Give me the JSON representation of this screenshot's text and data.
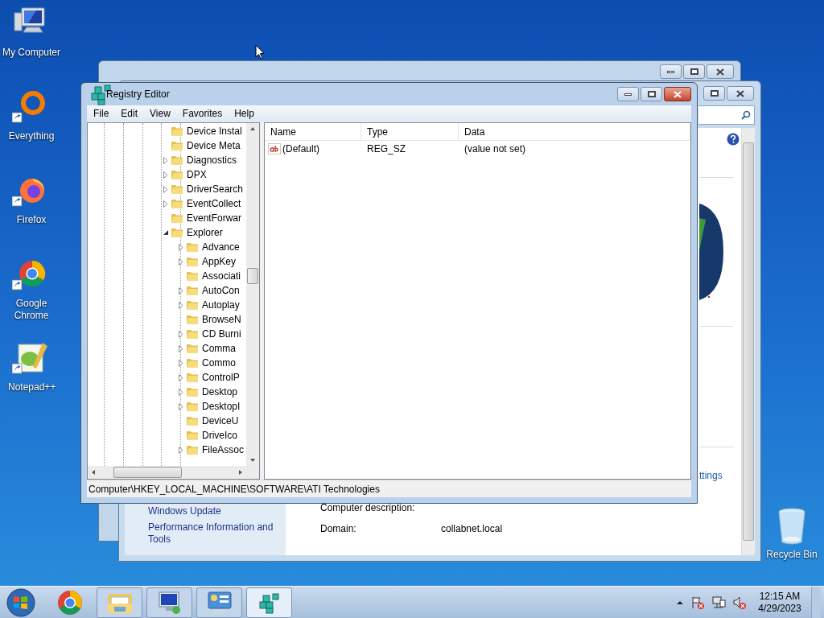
{
  "desktop_icons": [
    {
      "label": "My Computer",
      "kind": "computer",
      "shortcut": false
    },
    {
      "label": "Everything",
      "kind": "everything",
      "shortcut": true
    },
    {
      "label": "Firefox",
      "kind": "firefox",
      "shortcut": true
    },
    {
      "label": "Google Chrome",
      "kind": "chrome",
      "shortcut": true
    },
    {
      "label": "Notepad++",
      "kind": "notepad",
      "shortcut": true
    }
  ],
  "recycle_bin": {
    "label": "Recycle Bin"
  },
  "system_window": {
    "sidebar_links": [
      "Windows Update",
      "Performance Information and Tools"
    ],
    "fields": [
      {
        "label": "Computer description:"
      },
      {
        "label": "Domain:",
        "value": "collabnet.local"
      }
    ],
    "link_fragment": "ttings"
  },
  "registry_editor": {
    "title": "Registry Editor",
    "menu": [
      "File",
      "Edit",
      "View",
      "Favorites",
      "Help"
    ],
    "tree": [
      {
        "label": "Device Instal",
        "has_children": false,
        "expanded": false
      },
      {
        "label": "Device Meta",
        "has_children": false,
        "expanded": false
      },
      {
        "label": "Diagnostics",
        "has_children": true,
        "expanded": false
      },
      {
        "label": "DPX",
        "has_children": true,
        "expanded": false
      },
      {
        "label": "DriverSearch",
        "has_children": true,
        "expanded": false
      },
      {
        "label": "EventCollect",
        "has_children": true,
        "expanded": false
      },
      {
        "label": "EventForwar",
        "has_children": false,
        "expanded": false
      },
      {
        "label": "Explorer",
        "has_children": true,
        "expanded": true,
        "children": [
          {
            "label": "Advance",
            "has_children": true,
            "expanded": false
          },
          {
            "label": "AppKey",
            "has_children": true,
            "expanded": false
          },
          {
            "label": "Associati",
            "has_children": false,
            "expanded": false
          },
          {
            "label": "AutoCon",
            "has_children": true,
            "expanded": false
          },
          {
            "label": "Autoplay",
            "has_children": true,
            "expanded": false
          },
          {
            "label": "BrowseN",
            "has_children": false,
            "expanded": false
          },
          {
            "label": "CD Burni",
            "has_children": true,
            "expanded": false
          },
          {
            "label": "Comma",
            "has_children": true,
            "expanded": false
          },
          {
            "label": "Commo",
            "has_children": true,
            "expanded": false
          },
          {
            "label": "ControlP",
            "has_children": true,
            "expanded": false
          },
          {
            "label": "Desktop",
            "has_children": true,
            "expanded": false
          },
          {
            "label": "DesktopI",
            "has_children": true,
            "expanded": false
          },
          {
            "label": "DeviceU",
            "has_children": false,
            "expanded": false
          },
          {
            "label": "DriveIco",
            "has_children": false,
            "expanded": false
          },
          {
            "label": "FileAssoc",
            "has_children": true,
            "expanded": false
          }
        ]
      }
    ],
    "columns": [
      "Name",
      "Type",
      "Data"
    ],
    "values": [
      {
        "name": "(Default)",
        "type": "REG_SZ",
        "data": "(value not set)"
      }
    ],
    "status_bar": "Computer\\HKEY_LOCAL_MACHINE\\SOFTWARE\\ATI Technologies"
  },
  "taskbar": {
    "items": [
      {
        "kind": "chrome",
        "open": false,
        "active": false
      },
      {
        "kind": "explorer",
        "open": true,
        "active": false
      },
      {
        "kind": "remote",
        "open": true,
        "active": false
      },
      {
        "kind": "control",
        "open": true,
        "active": false
      },
      {
        "kind": "regedit",
        "open": true,
        "active": true
      }
    ],
    "clock": {
      "time": "12:15 AM",
      "date": "4/29/2023"
    }
  }
}
